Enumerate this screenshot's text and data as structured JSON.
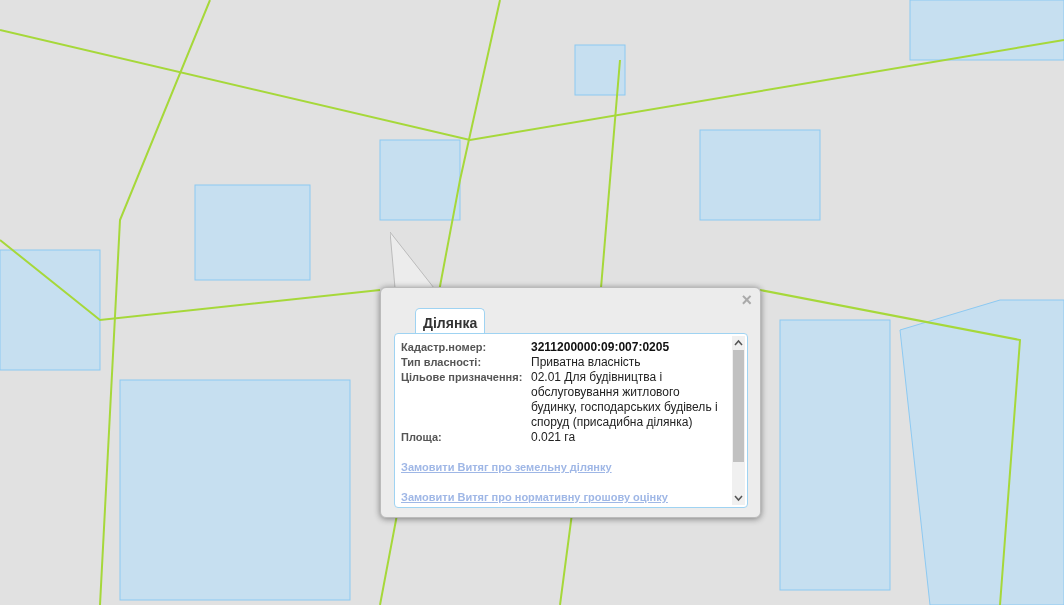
{
  "popup": {
    "close": "×",
    "tabs": [
      {
        "label": "Ділянка",
        "selected": true
      }
    ],
    "rows": [
      {
        "label": "Кадастр.номер:",
        "value": "3211200000:09:007:0205",
        "bold": true
      },
      {
        "label": "Тип власності:",
        "value": "Приватна власність",
        "bold": false
      },
      {
        "label": "Цільове призначення:",
        "value": "02.01 Для будівництва і обслуговування житлового будинку, господарських будівель і споруд (присадибна ділянка)",
        "bold": false
      },
      {
        "label": "Площа:",
        "value": "0.021 га",
        "bold": false
      }
    ],
    "links": [
      "Замовити Витяг про земельну ділянку",
      "Замовити Витяг про нормативну грошову оцінку"
    ]
  }
}
